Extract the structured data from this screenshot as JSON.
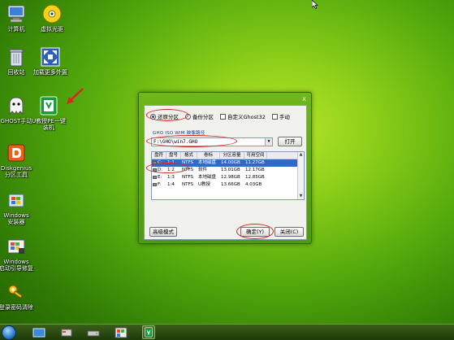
{
  "desktop": {
    "icons": [
      {
        "label": "计算机"
      },
      {
        "label": "虚拟光驱"
      },
      {
        "label": "回收站"
      },
      {
        "label": "加载更多外置"
      },
      {
        "label": "GHOST手动"
      },
      {
        "label": "U教授PE一键",
        "label2": "装机"
      },
      {
        "label": "Diskgenius",
        "label2": "分区工具"
      },
      {
        "label": "Windows",
        "label2": "安装器"
      },
      {
        "label": "Windows",
        "label2": "启动引导修复"
      },
      {
        "label": "登录密码清除"
      }
    ]
  },
  "dialog": {
    "close_glyph": "x",
    "radio_restore": "还原分区",
    "radio_backup": "备份分区",
    "check_custom": "自定义Ghost32",
    "check_manual": "手动",
    "section_label": "GHO ISO WIM 映像路径",
    "path_value": "F:\\GHO\\win7.GHO",
    "open_button": "打开",
    "table": {
      "headers": [
        "盘符",
        "盘号",
        "格式",
        "卷标",
        "分区容量",
        "可用空间"
      ],
      "rows": [
        {
          "drive": "C:",
          "num": "1:1",
          "fs": "NTFS",
          "label": "本地磁盘",
          "size": "14.00GB",
          "free": "11.27GB"
        },
        {
          "drive": "D:",
          "num": "1:2",
          "fs": "NTFS",
          "label": "软件",
          "size": "13.01GB",
          "free": "12.17GB"
        },
        {
          "drive": "E:",
          "num": "1:3",
          "fs": "NTFS",
          "label": "本地磁盘",
          "size": "12.98GB",
          "free": "12.85GB"
        },
        {
          "drive": "F:",
          "num": "1:4",
          "fs": "NTFS",
          "label": "U教授",
          "size": "13.66GB",
          "free": "4.03GB"
        }
      ]
    },
    "advanced_button": "高级模式",
    "ok_button": "确定(Y)",
    "close_button": "关闭(C)"
  },
  "colors": {
    "desktop_green": "#52a80c",
    "annotation_red": "#d8281c",
    "selection_blue": "#3169c6"
  }
}
